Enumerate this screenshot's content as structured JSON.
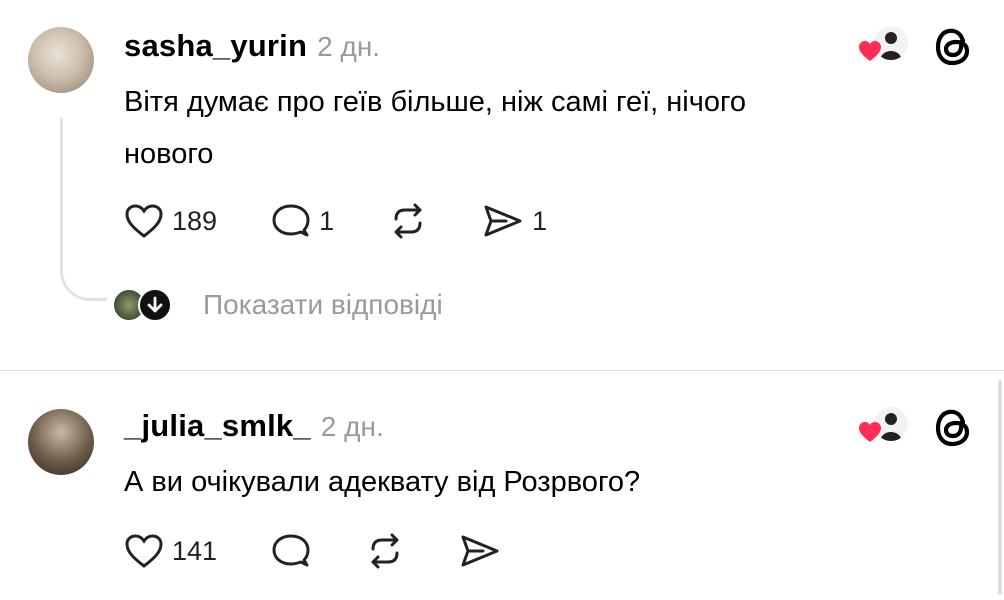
{
  "posts": [
    {
      "username": "sasha_yurin",
      "time": "2 дн.",
      "text_line1": "Вітя думає про геїв більше, ніж самі геї, нічого",
      "text_line2": "нового",
      "likes": "189",
      "comments": "1",
      "shares": "1",
      "show_replies": "Показати відповіді"
    },
    {
      "username": "_julia_smlk_",
      "time": "2 дн.",
      "text_line1": "А ви очікували адеквату від Розрвого?",
      "likes": "141"
    }
  ],
  "colors": {
    "heart": "#ff2d55",
    "muted": "#9a9a9a",
    "line": "#e3e3e3"
  }
}
